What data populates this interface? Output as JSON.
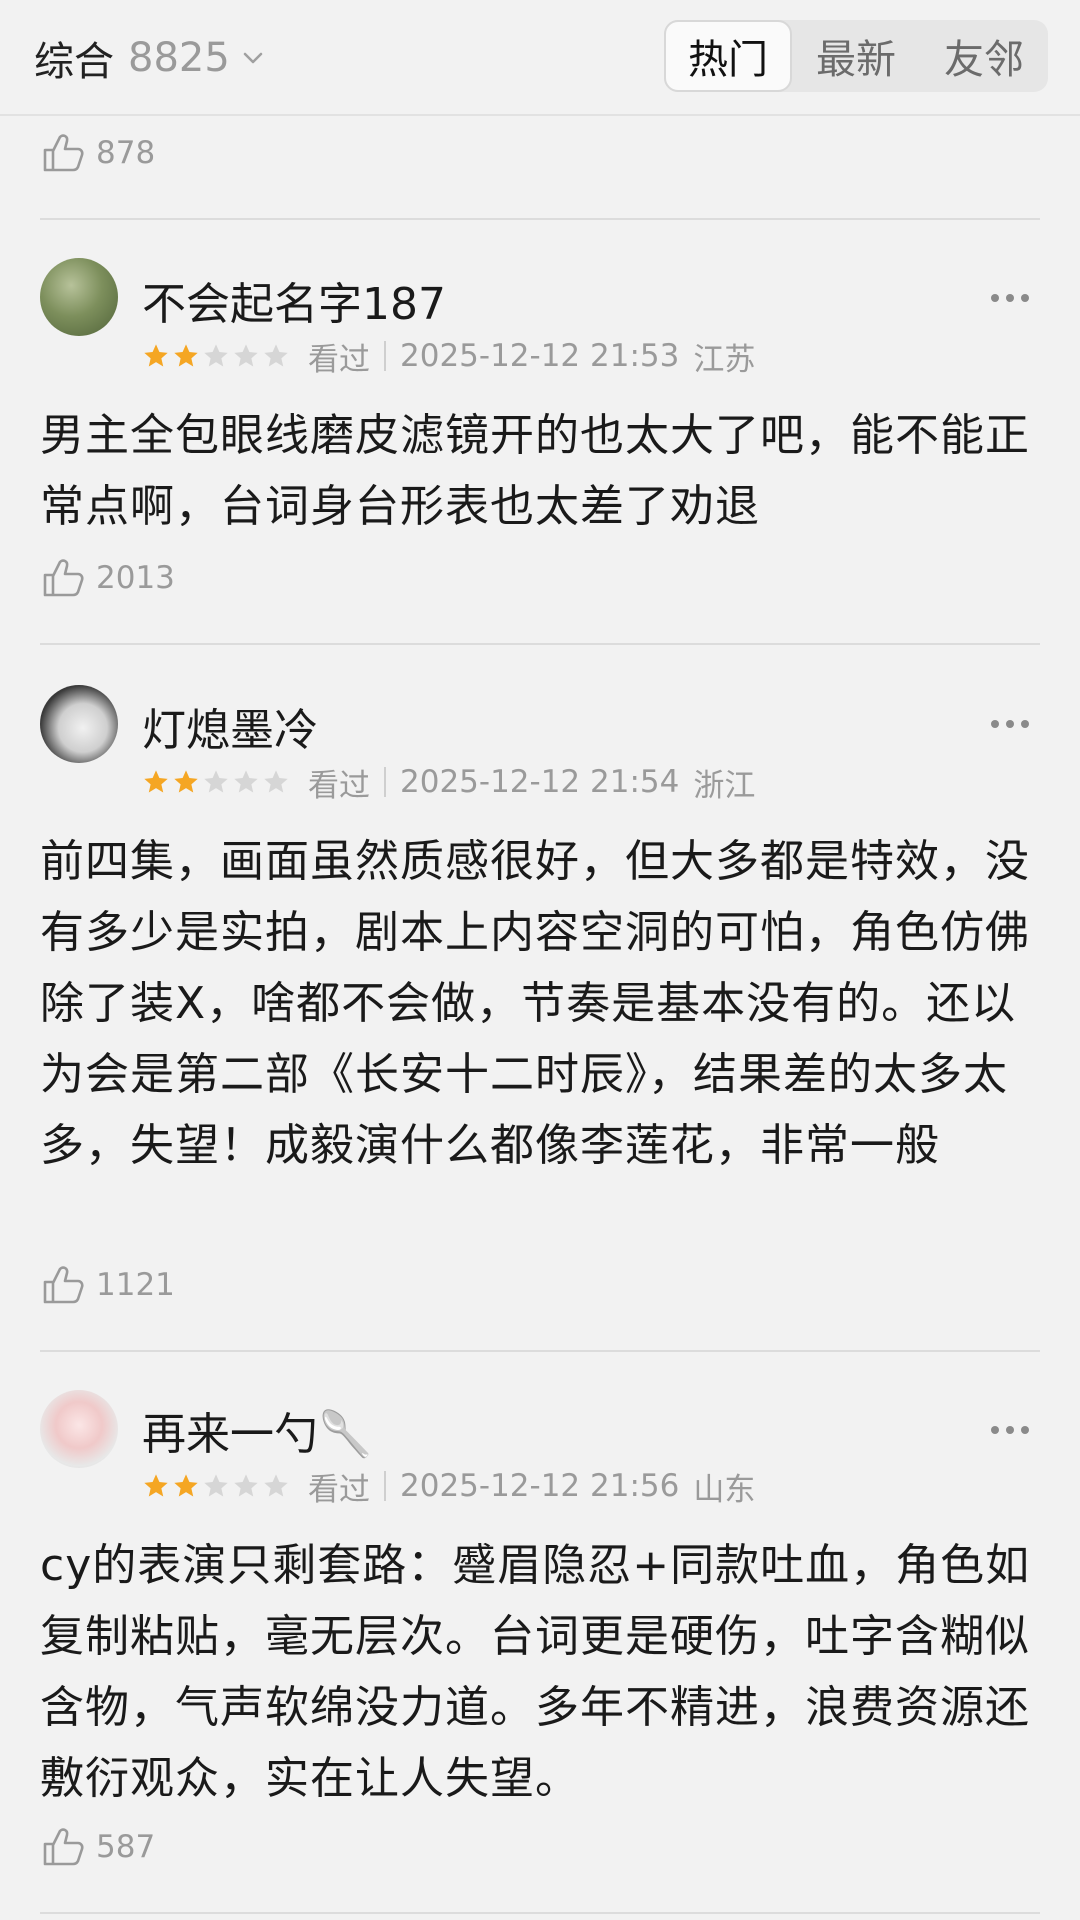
{
  "header": {
    "filter_label": "综合",
    "filter_count": "8825",
    "tabs": [
      {
        "label": "热门",
        "active": true
      },
      {
        "label": "最新",
        "active": false
      },
      {
        "label": "友邻",
        "active": false
      }
    ]
  },
  "top_like_count": "878",
  "comments": [
    {
      "username": "不会起名字187",
      "rating": 2,
      "status": "看过",
      "time": "2025-12-12 21:53",
      "region": "江苏",
      "text": "男主全包眼线磨皮滤镜开的也太大了吧，能不能正常点啊，台词身台形表也太差了劝退",
      "likes": "2013"
    },
    {
      "username": "灯熄墨冷",
      "rating": 2,
      "status": "看过",
      "time": "2025-12-12 21:54",
      "region": "浙江",
      "text": "前四集，画面虽然质感很好，但大多都是特效，没有多少是实拍，剧本上内容空洞的可怕，角色仿佛除了装X，啥都不会做，节奏是基本没有的。还以为会是第二部《长安十二时辰》，结果差的太多太多，失望！成毅演什么都像李莲花，非常一般",
      "likes": "1121"
    },
    {
      "username": "再来一勺🥄",
      "rating": 2,
      "status": "看过",
      "time": "2025-12-12 21:56",
      "region": "山东",
      "text": "cy的表演只剩套路：蹙眉隐忍+同款吐血，角色如复制粘贴，毫无层次。台词更是硬伤，吐字含糊似含物，气声软绵没力道。多年不精进，浪费资源还敷衍观众，实在让人失望。",
      "likes": "587"
    }
  ],
  "colors": {
    "star_filled": "#f5a623",
    "star_empty": "#d6d6d6",
    "muted": "#9a9a9a"
  }
}
